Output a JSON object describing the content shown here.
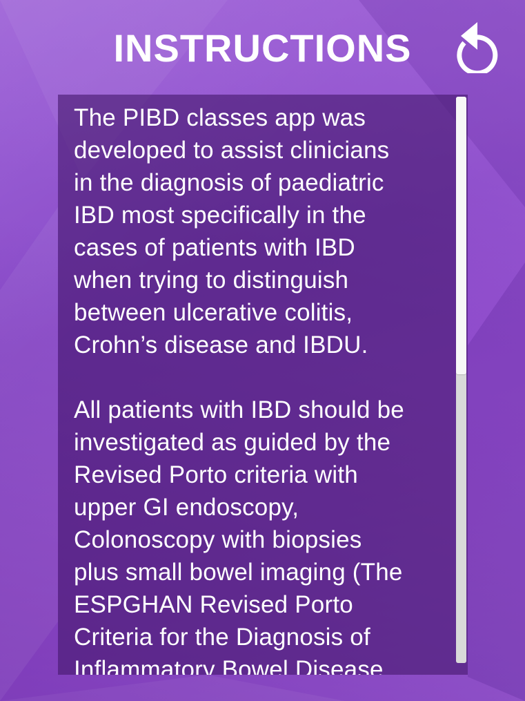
{
  "header": {
    "title": "INSTRUCTIONS",
    "refresh_icon": "refresh-icon"
  },
  "content": {
    "paragraphs": [
      "The PIBD classes app was\ndeveloped to assist clinicians\nin the diagnosis of paediatric\nIBD most specifically in the\ncases of patients with IBD\nwhen trying to distinguish\nbetween ulcerative colitis,\nCrohn’s disease and IBDU.",
      "All patients with IBD should be\ninvestigated as guided by the\nRevised Porto criteria with\nupper GI endoscopy,\nColonoscopy with biopsies\nplus small bowel imaging (The\nESPGHAN Revised Porto\nCriteria for the Diagnosis of\nInflammatory Bowel Disease"
    ]
  },
  "scrollbar": {
    "position_fraction": 0.0,
    "visible_fraction": 0.49
  },
  "colors": {
    "background": "#8a4fc6",
    "panel": "#46196e",
    "text": "#ffffff",
    "scroll_track": "#d9d9d9",
    "scroll_thumb": "#f7f7f7"
  }
}
